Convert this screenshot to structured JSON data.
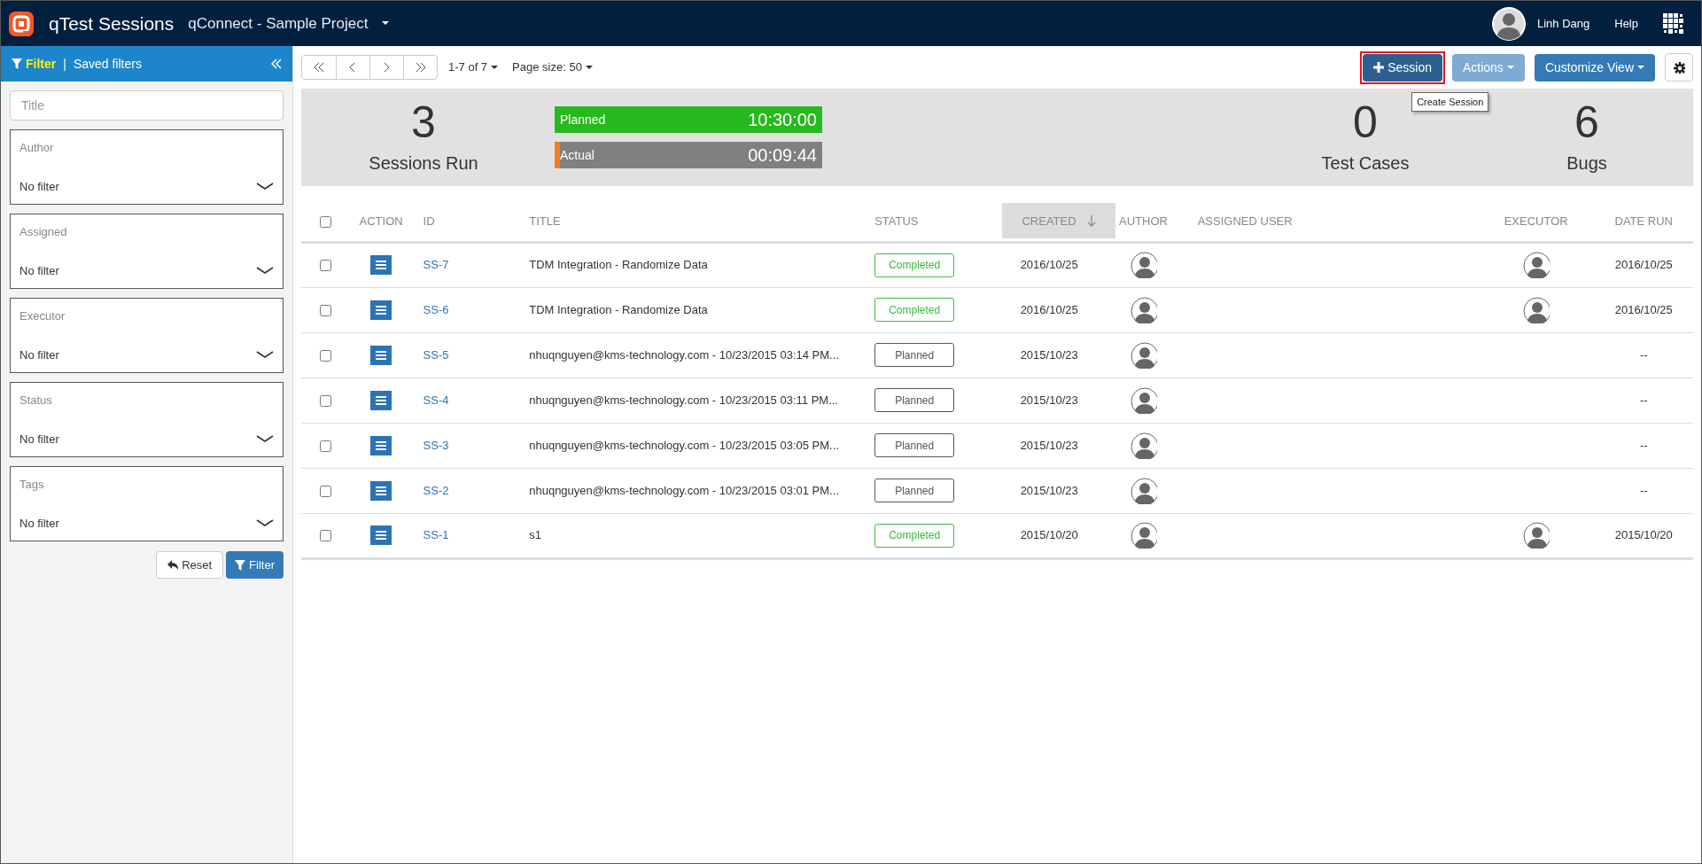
{
  "header": {
    "app_title": "qTest Sessions",
    "project": "qConnect - Sample Project",
    "user_name": "Linh Dang",
    "help": "Help"
  },
  "filter_panel": {
    "tabs": [
      {
        "label": "Filter",
        "selected": true
      },
      {
        "label": "Saved filters",
        "selected": false
      }
    ],
    "separator": "|",
    "title_field": {
      "placeholder": "Title"
    },
    "filters": [
      {
        "label": "Author",
        "value": "No filter"
      },
      {
        "label": "Assigned",
        "value": "No filter"
      },
      {
        "label": "Executor",
        "value": "No filter"
      },
      {
        "label": "Status",
        "value": "No filter"
      },
      {
        "label": "Tags",
        "value": "No filter"
      }
    ],
    "buttons": [
      {
        "label": "Reset",
        "kind": "reset"
      },
      {
        "label": "Filter",
        "kind": "apply"
      }
    ]
  },
  "toolbar": {
    "range": "1-7 of 7",
    "page_size": "Page size: 50",
    "buttons": [
      {
        "label": "Session",
        "kind": "add",
        "disabled": false,
        "highlighted": true
      },
      {
        "label": "Actions",
        "kind": "dropdown",
        "disabled": true,
        "highlighted": false
      },
      {
        "label": "Customize View",
        "kind": "dropdown",
        "disabled": false,
        "highlighted": false
      }
    ],
    "tooltip": "Create Session"
  },
  "stats": {
    "sessions_run": {
      "value": "3",
      "label": "Sessions Run"
    },
    "time_bars": [
      {
        "label": "Planned",
        "value": "10:30:00",
        "level": 1,
        "color": "#27b91f"
      },
      {
        "label": "Actual",
        "value": "00:09:44",
        "level": 0.01,
        "color": "#f57c20"
      }
    ],
    "test_cases": {
      "value": "0",
      "label": "Test Cases"
    },
    "bugs": {
      "value": "6",
      "label": "Bugs"
    }
  },
  "table": {
    "select_all_checked": false,
    "columns": [
      {
        "label": "ACTION",
        "sorted": false
      },
      {
        "label": "ID",
        "sorted": false
      },
      {
        "label": "TITLE",
        "sorted": false
      },
      {
        "label": "STATUS",
        "sorted": false
      },
      {
        "label": "CREATED",
        "sorted": true
      },
      {
        "label": "AUTHOR",
        "sorted": false
      },
      {
        "label": "ASSIGNED USER",
        "sorted": false
      },
      {
        "label": "EXECUTOR",
        "sorted": false
      },
      {
        "label": "DATE RUN",
        "sorted": false
      }
    ],
    "rows": [
      {
        "checked": false,
        "id": "SS-7",
        "title": "TDM Integration - Randomize Data",
        "status": "Completed",
        "kind": "completed",
        "created": "2016/10/25",
        "executor": true,
        "date_run": "2016/10/25"
      },
      {
        "checked": false,
        "id": "SS-6",
        "title": "TDM Integration - Randomize Data",
        "status": "Completed",
        "kind": "completed",
        "created": "2016/10/25",
        "executor": true,
        "date_run": "2016/10/25"
      },
      {
        "checked": false,
        "id": "SS-5",
        "title": "nhuqnguyen@kms-technology.com - 10/23/2015 03:14 PM...",
        "status": "Planned",
        "kind": "planned",
        "created": "2015/10/23",
        "executor": false,
        "date_run": "--"
      },
      {
        "checked": false,
        "id": "SS-4",
        "title": "nhuqnguyen@kms-technology.com - 10/23/2015 03:11 PM...",
        "status": "Planned",
        "kind": "planned",
        "created": "2015/10/23",
        "executor": false,
        "date_run": "--"
      },
      {
        "checked": false,
        "id": "SS-3",
        "title": "nhuqnguyen@kms-technology.com - 10/23/2015 03:05 PM...",
        "status": "Planned",
        "kind": "planned",
        "created": "2015/10/23",
        "executor": false,
        "date_run": "--"
      },
      {
        "checked": false,
        "id": "SS-2",
        "title": "nhuqnguyen@kms-technology.com - 10/23/2015 03:01 PM...",
        "status": "Planned",
        "kind": "planned",
        "created": "2015/10/23",
        "executor": false,
        "date_run": "--"
      },
      {
        "checked": false,
        "id": "SS-1",
        "title": "s1",
        "status": "Completed",
        "kind": "completed",
        "created": "2015/10/20",
        "executor": true,
        "date_run": "2015/10/20"
      }
    ]
  }
}
